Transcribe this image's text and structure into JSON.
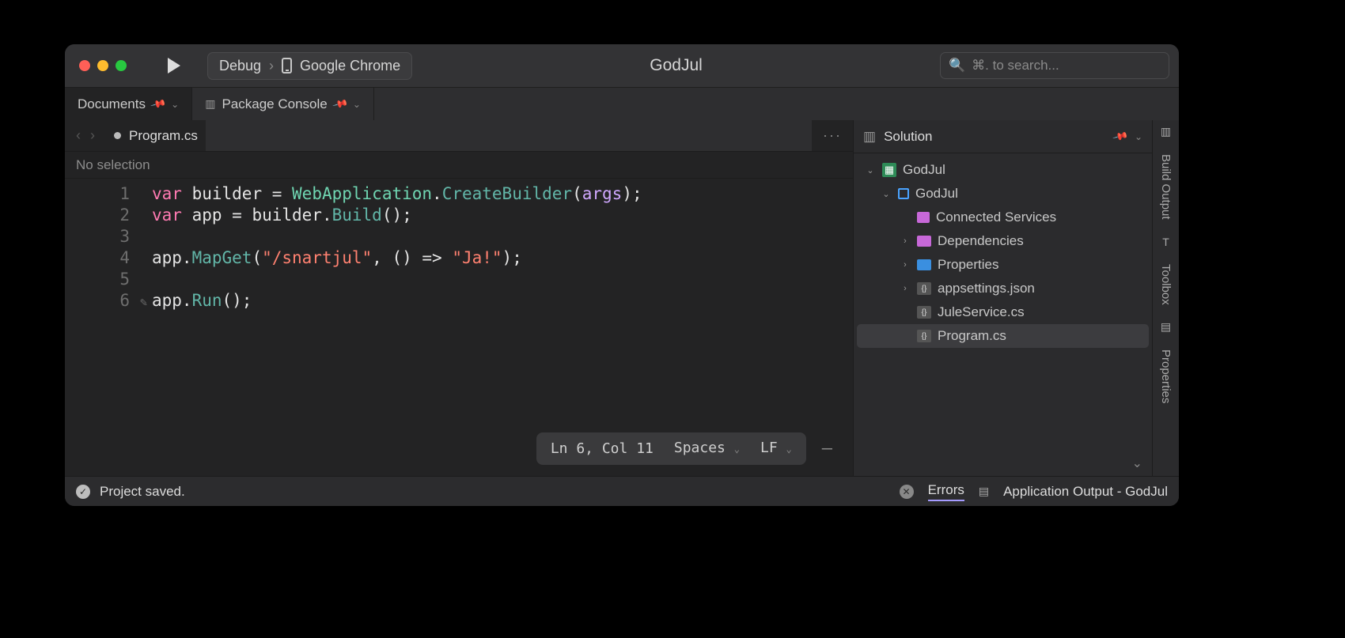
{
  "window": {
    "title": "GodJul",
    "search_placeholder": "⌘. to search..."
  },
  "run": {
    "config": "Debug",
    "target": "Google Chrome"
  },
  "tool_tabs": {
    "documents": "Documents",
    "package_console": "Package Console"
  },
  "solution_panel": {
    "title": "Solution"
  },
  "file": {
    "name": "Program.cs",
    "dirty": true
  },
  "breadcrumb": "No selection",
  "code_lines": [
    {
      "n": "1",
      "tokens": [
        [
          "kw",
          "var"
        ],
        [
          "plain",
          " builder "
        ],
        [
          "plain",
          "= "
        ],
        [
          "type",
          "WebApplication"
        ],
        [
          "plain",
          "."
        ],
        [
          "method",
          "CreateBuilder"
        ],
        [
          "plain",
          "("
        ],
        [
          "param",
          "args"
        ],
        [
          "plain",
          ");"
        ]
      ]
    },
    {
      "n": "2",
      "tokens": [
        [
          "kw",
          "var"
        ],
        [
          "plain",
          " app "
        ],
        [
          "plain",
          "= "
        ],
        [
          "plain",
          "builder."
        ],
        [
          "method",
          "Build"
        ],
        [
          "plain",
          "();"
        ]
      ]
    },
    {
      "n": "3",
      "tokens": []
    },
    {
      "n": "4",
      "tokens": [
        [
          "plain",
          "app."
        ],
        [
          "method",
          "MapGet"
        ],
        [
          "plain",
          "("
        ],
        [
          "str",
          "\"/snartjul\""
        ],
        [
          "plain",
          ", () => "
        ],
        [
          "str",
          "\"Ja!\""
        ],
        [
          "plain",
          ");"
        ]
      ]
    },
    {
      "n": "5",
      "tokens": []
    },
    {
      "n": "6",
      "mark": true,
      "tokens": [
        [
          "plain",
          "app."
        ],
        [
          "method",
          "Run"
        ],
        [
          "plain",
          "();"
        ]
      ]
    }
  ],
  "editor_status": {
    "position": "Ln 6, Col 11",
    "indent": "Spaces",
    "eol": "LF"
  },
  "solution": {
    "root": "GodJul",
    "project": "GodJul",
    "items": [
      {
        "label": "Connected Services",
        "kind": "svc"
      },
      {
        "label": "Dependencies",
        "kind": "fldp",
        "expandable": true
      },
      {
        "label": "Properties",
        "kind": "fld",
        "expandable": true
      },
      {
        "label": "appsettings.json",
        "kind": "cs",
        "expandable": true
      },
      {
        "label": "JuleService.cs",
        "kind": "cs"
      },
      {
        "label": "Program.cs",
        "kind": "cs",
        "selected": true
      }
    ]
  },
  "rail": {
    "build_output": "Build Output",
    "toolbox": "Toolbox",
    "properties": "Properties"
  },
  "status": {
    "message": "Project saved.",
    "errors_label": "Errors",
    "output_label": "Application Output - GodJul"
  }
}
